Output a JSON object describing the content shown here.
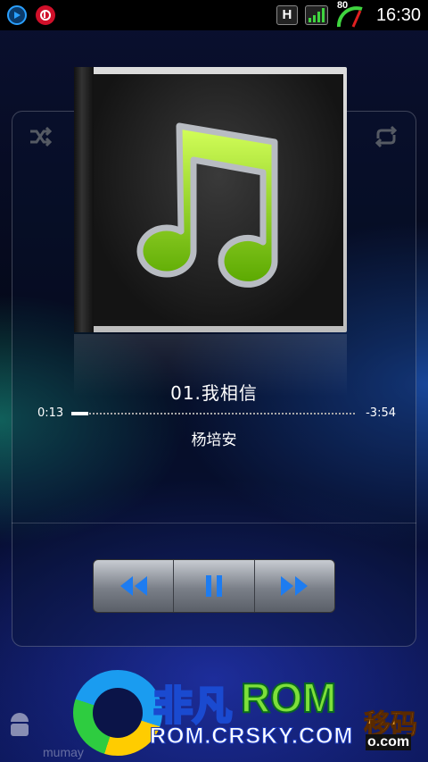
{
  "status_bar": {
    "network_type": "H",
    "battery_level": "80",
    "time": "16:30",
    "icons": [
      "media-play-icon",
      "beats-audio-icon",
      "hspa-icon",
      "signal-icon",
      "battery-gauge-icon"
    ]
  },
  "player": {
    "shuffle_icon": "shuffle-icon",
    "repeat_icon": "repeat-icon",
    "album_art": "music-note-icon",
    "track_title": "01.我相信",
    "elapsed": "0:13",
    "remaining": "-3:54",
    "progress": 0.06,
    "artist": "杨培安"
  },
  "transport": {
    "buttons": [
      "rewind-icon",
      "pause-icon",
      "fast-forward-icon"
    ],
    "accent_color": "#1e7cf0"
  },
  "watermark": {
    "logo_text_cn": "非凡",
    "logo_text_rom": "ROM",
    "url": "ROM.CRSKY.COM",
    "side_text": "移码",
    "side_domain": "o.com",
    "small_text": "mumay"
  }
}
